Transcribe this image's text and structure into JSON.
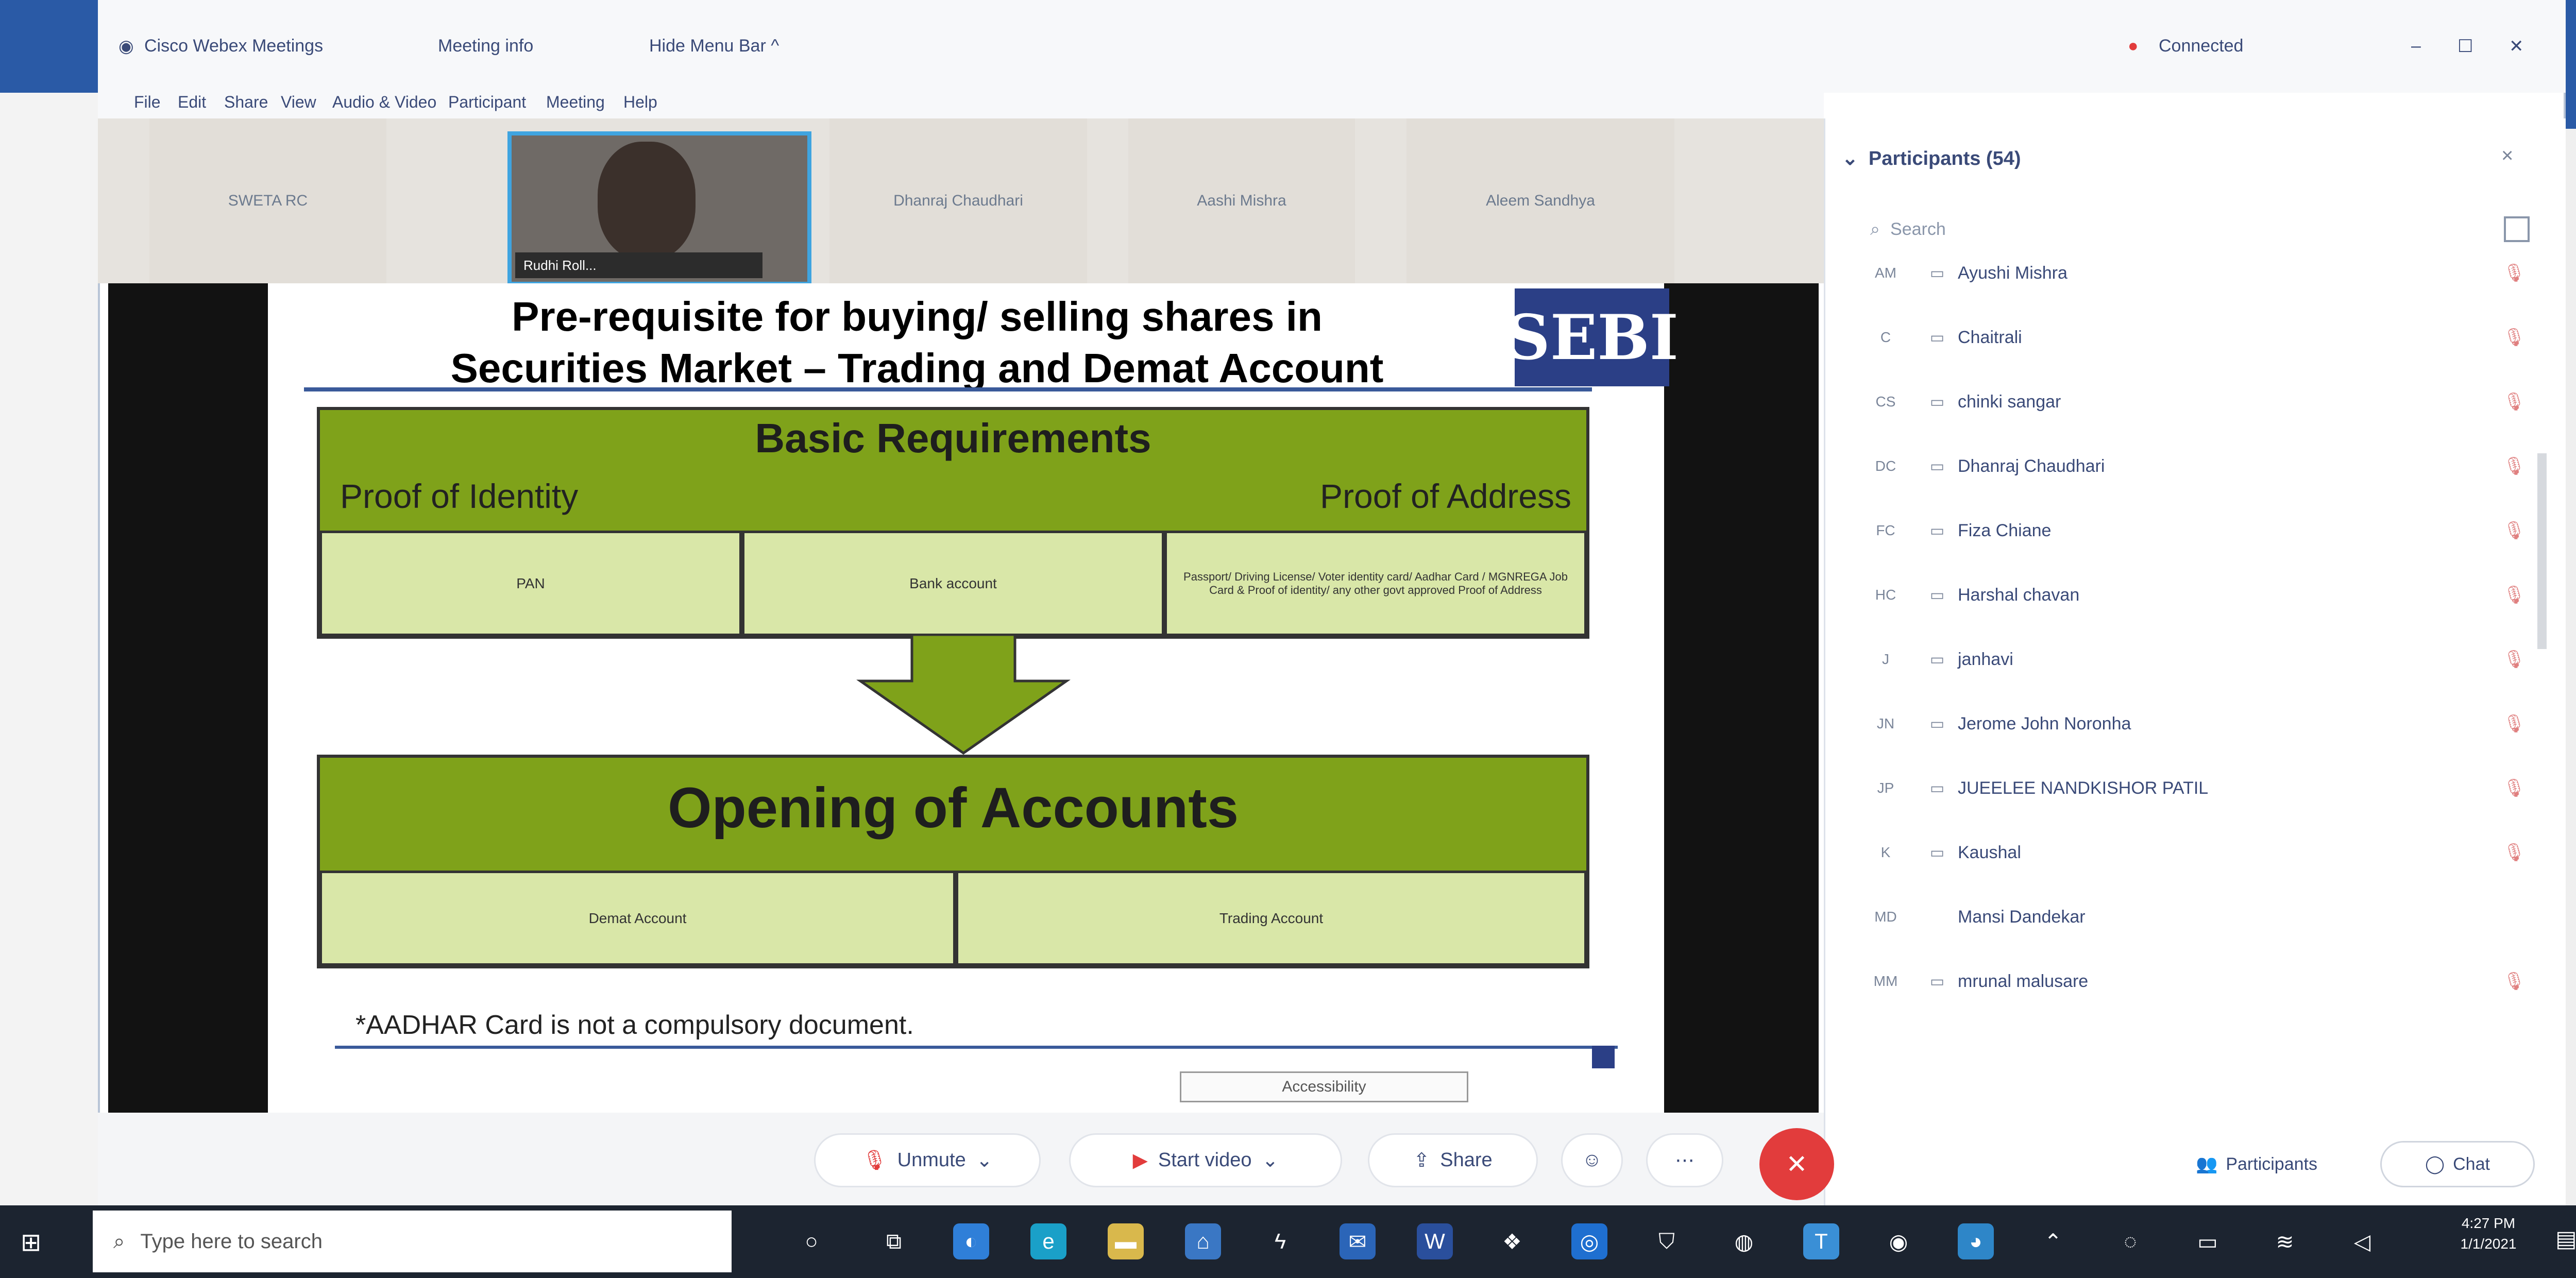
{
  "window": {
    "app_title": "Cisco Webex Meetings",
    "meeting_info": "Meeting info",
    "hide_menu": "Hide Menu Bar ^",
    "status": "Connected",
    "status_color": "#e23c3c",
    "controls": {
      "minimize": "–",
      "maximize": "☐",
      "close": "✕"
    }
  },
  "menu": [
    "File",
    "Edit",
    "Share",
    "View",
    "Audio & Video",
    "Participant",
    "Meeting",
    "Help"
  ],
  "thumbnails": [
    {
      "label": "SWETA RC"
    },
    {
      "label": "Dhanraj Chaudhari"
    },
    {
      "label": "Aashi Mishra"
    },
    {
      "label": "Aleem Sandhya"
    }
  ],
  "video_thumb": {
    "label": "Rudhi Roll..."
  },
  "slide": {
    "title_line1": "Pre-requisite for buying/ selling shares in",
    "title_line2": "Securities Market – Trading and Demat Account",
    "logo": "SEBI",
    "basic_requirements": "Basic Requirements",
    "proof_identity": "Proof of Identity",
    "proof_address": "Proof of Address",
    "req_cells": [
      "PAN",
      "Bank account",
      "Passport/ Driving License/ Voter identity card/ Aadhar Card / MGNREGA Job Card & Proof of identity/ any other govt approved Proof of Address"
    ],
    "opening_heading": "Opening of Accounts",
    "open_cells": [
      "Demat Account",
      "Trading Account"
    ],
    "footnote": "*AADHAR Card is not a compulsory document.",
    "tag": "Accessibility"
  },
  "panel": {
    "title": "Participants (54)",
    "close": "×",
    "search_placeholder": "Search",
    "participants": [
      {
        "initials": "AM",
        "name": "Ayushi Mishra",
        "muted": true
      },
      {
        "initials": "C",
        "name": "Chaitrali",
        "muted": true
      },
      {
        "initials": "CS",
        "name": "chinki sangar",
        "muted": true
      },
      {
        "initials": "DC",
        "name": "Dhanraj Chaudhari",
        "muted": true
      },
      {
        "initials": "FC",
        "name": "Fiza Chiane",
        "muted": true
      },
      {
        "initials": "HC",
        "name": "Harshal chavan",
        "muted": true
      },
      {
        "initials": "J",
        "name": "janhavi",
        "muted": true
      },
      {
        "initials": "JN",
        "name": "Jerome John Noronha",
        "muted": true
      },
      {
        "initials": "JP",
        "name": "JUEELEE NANDKISHOR PATIL",
        "muted": true
      },
      {
        "initials": "K",
        "name": "Kaushal",
        "muted": true
      },
      {
        "initials": "MD",
        "name": "Mansi Dandekar",
        "muted": false
      },
      {
        "initials": "MM",
        "name": "mrunal malusare",
        "muted": true
      }
    ]
  },
  "controls": {
    "unmute": "Unmute",
    "start_video": "Start video",
    "share": "Share",
    "participants": "Participants",
    "chat": "Chat"
  },
  "taskbar": {
    "search_placeholder": "Type here to search",
    "time": "4:27 PM",
    "date": "1/1/2021"
  }
}
